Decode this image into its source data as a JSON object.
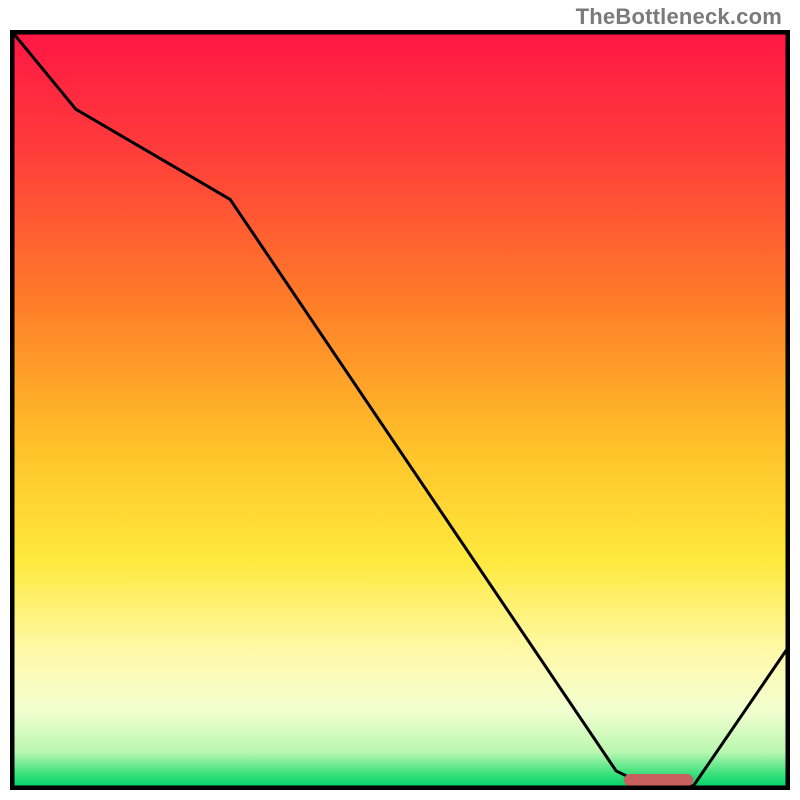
{
  "watermark": "TheBottleneck.com",
  "chart_data": {
    "type": "line",
    "title": "",
    "xlabel": "",
    "ylabel": "",
    "xlim": [
      0,
      100
    ],
    "ylim": [
      0,
      100
    ],
    "x": [
      0,
      8,
      28,
      78,
      82,
      88,
      100
    ],
    "values": [
      100,
      90,
      78,
      2,
      0,
      0,
      18
    ],
    "marker": {
      "x_start": 79,
      "x_end": 88,
      "y": 0.8,
      "color": "#c7605f",
      "thickness": 1.6
    },
    "gradient_stops": [
      {
        "offset": 0.0,
        "color": "#ff1744"
      },
      {
        "offset": 0.15,
        "color": "#ff3b3b"
      },
      {
        "offset": 0.35,
        "color": "#ff7a29"
      },
      {
        "offset": 0.55,
        "color": "#ffc229"
      },
      {
        "offset": 0.7,
        "color": "#ffe93d"
      },
      {
        "offset": 0.82,
        "color": "#fff9a8"
      },
      {
        "offset": 0.9,
        "color": "#f2ffd0"
      },
      {
        "offset": 0.955,
        "color": "#b9f7b0"
      },
      {
        "offset": 0.985,
        "color": "#35e07a"
      },
      {
        "offset": 1.0,
        "color": "#07d16a"
      }
    ],
    "frame_color": "#000000",
    "line_color": "#000000",
    "line_width": 3
  }
}
